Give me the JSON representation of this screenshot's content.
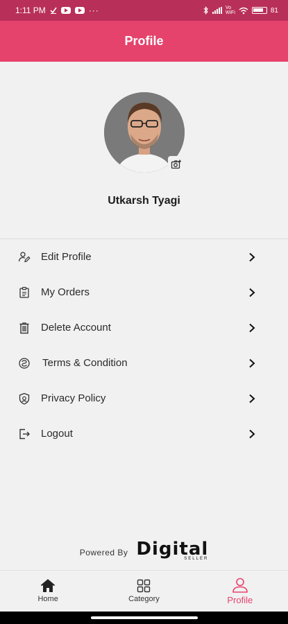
{
  "status_bar": {
    "time": "1:11 PM",
    "network_label": "Vo WiFi",
    "battery": "81"
  },
  "header": {
    "title": "Profile"
  },
  "profile": {
    "name": "Utkarsh Tyagi"
  },
  "menu": {
    "items": [
      {
        "label": "Edit Profile",
        "icon": "edit-user-icon"
      },
      {
        "label": "My Orders",
        "icon": "orders-clipboard-icon"
      },
      {
        "label": "Delete Account",
        "icon": "trash-icon"
      },
      {
        "label": "Terms & Condition",
        "icon": "terms-icon"
      },
      {
        "label": "Privacy Policy",
        "icon": "shield-icon"
      },
      {
        "label": "Logout",
        "icon": "logout-icon"
      }
    ]
  },
  "footer": {
    "powered_by": "Powered By",
    "brand": "Digital",
    "brand_sub": "SELLER"
  },
  "bottom_nav": {
    "items": [
      {
        "label": "Home",
        "icon": "home-icon",
        "active": false
      },
      {
        "label": "Category",
        "icon": "grid-icon",
        "active": false
      },
      {
        "label": "Profile",
        "icon": "user-icon",
        "active": true
      }
    ]
  },
  "colors": {
    "accent": "#e5436c",
    "status_bar": "#b8305a",
    "background": "#f1f1f1"
  }
}
